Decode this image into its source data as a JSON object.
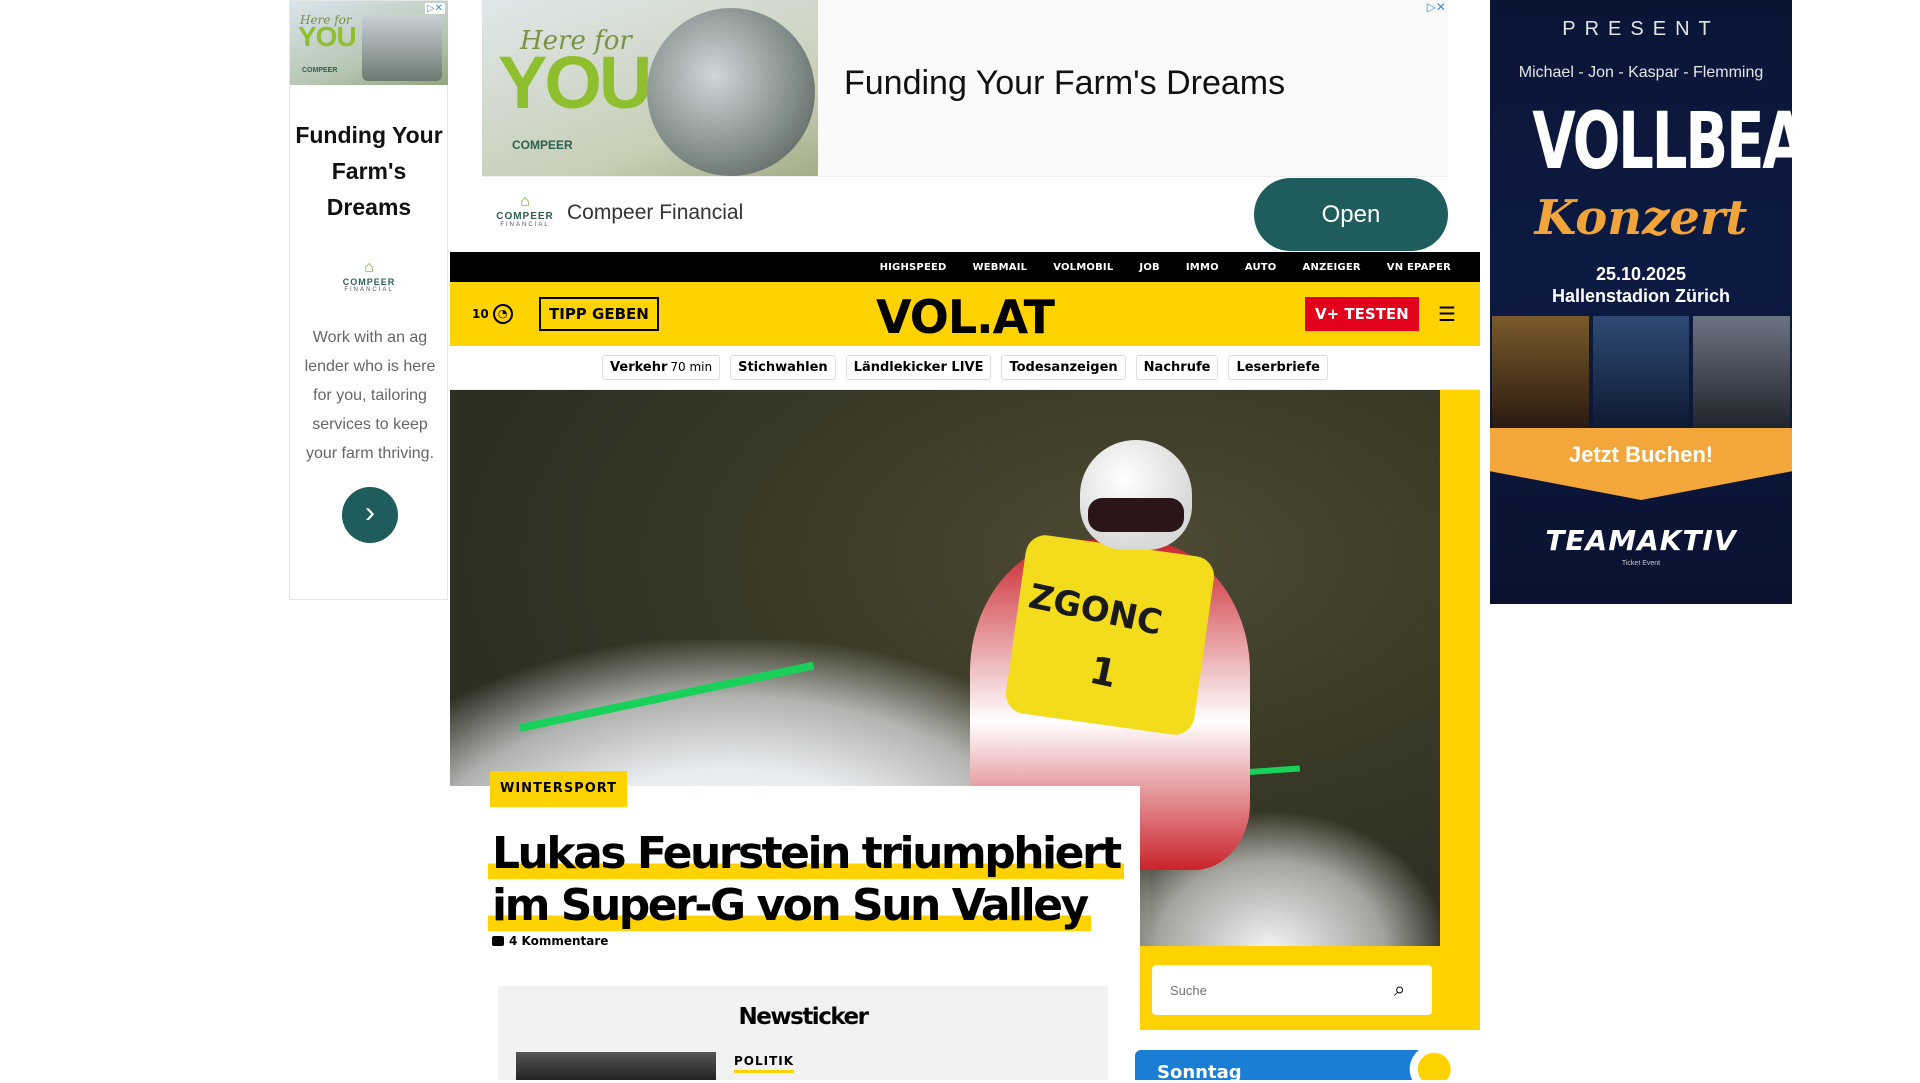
{
  "ad_left": {
    "thumb_here": "Here for",
    "thumb_you": "YOU",
    "thumb_logo": "COMPEER",
    "headline": "Funding Your Farm's Dreams",
    "logo_name": "COMPEER",
    "logo_sub": "FINANCIAL",
    "body": "Work with an ag lender who is here for you, tailoring services to keep your farm thriving.",
    "go_icon": "chevron-right-icon"
  },
  "ad_top": {
    "img_here": "Here for",
    "img_you": "YOU",
    "img_logo": "COMPEER",
    "headline": "Funding Your Farm's Dreams",
    "logo_name": "COMPEER",
    "logo_sub": "FINANCIAL",
    "company": "Compeer Financial",
    "open_label": "Open"
  },
  "ad_right": {
    "present": "PRESENT",
    "names": "Michael - Jon - Kaspar - Flemming",
    "band": "VOLLBEAT",
    "konzert": "Konzert",
    "date": "25.10.2025",
    "venue": "Hallenstadion Zürich",
    "cta": "Jetzt Buchen!",
    "team": "TEAMAKTIV",
    "team_sub": "Ticket Event"
  },
  "service_bar": {
    "items": [
      "HIGHSPEED",
      "WEBMAIL",
      "VOLMOBIL",
      "JOB",
      "IMMO",
      "AUTO",
      "ANZEIGER",
      "VN EPAPER"
    ]
  },
  "header": {
    "temperature": "10",
    "weather_icon": "partly-cloudy-icon",
    "tipp_label": "TIPP GEBEN",
    "logo": "VOL.AT",
    "vplus_label": "V+ TESTEN",
    "menu_icon": "menu-search-icon"
  },
  "trending": {
    "items": [
      {
        "label": "Verkehr",
        "meta": "70 min"
      },
      {
        "label": "Stichwahlen",
        "meta": ""
      },
      {
        "label": "Ländlekicker LIVE",
        "meta": ""
      },
      {
        "label": "Todesanzeigen",
        "meta": ""
      },
      {
        "label": "Nachrufe",
        "meta": ""
      },
      {
        "label": "Leserbriefe",
        "meta": ""
      }
    ]
  },
  "hero": {
    "tag": "WINTERSPORT",
    "headline": "Lukas Feurstein triumphiert im Super-G von Sun Valley",
    "comments": "4 Kommentare",
    "bib_text": "ZGONC",
    "bib_number": "1"
  },
  "search": {
    "placeholder": "Suche"
  },
  "ticker": {
    "title": "Newsticker",
    "category": "POLITIK"
  },
  "weather_widget": {
    "day": "Sonntag"
  },
  "colors": {
    "brand_yellow": "#ffd200",
    "vplus_red": "#e3001b",
    "ad_teal": "#1f5c5c"
  }
}
